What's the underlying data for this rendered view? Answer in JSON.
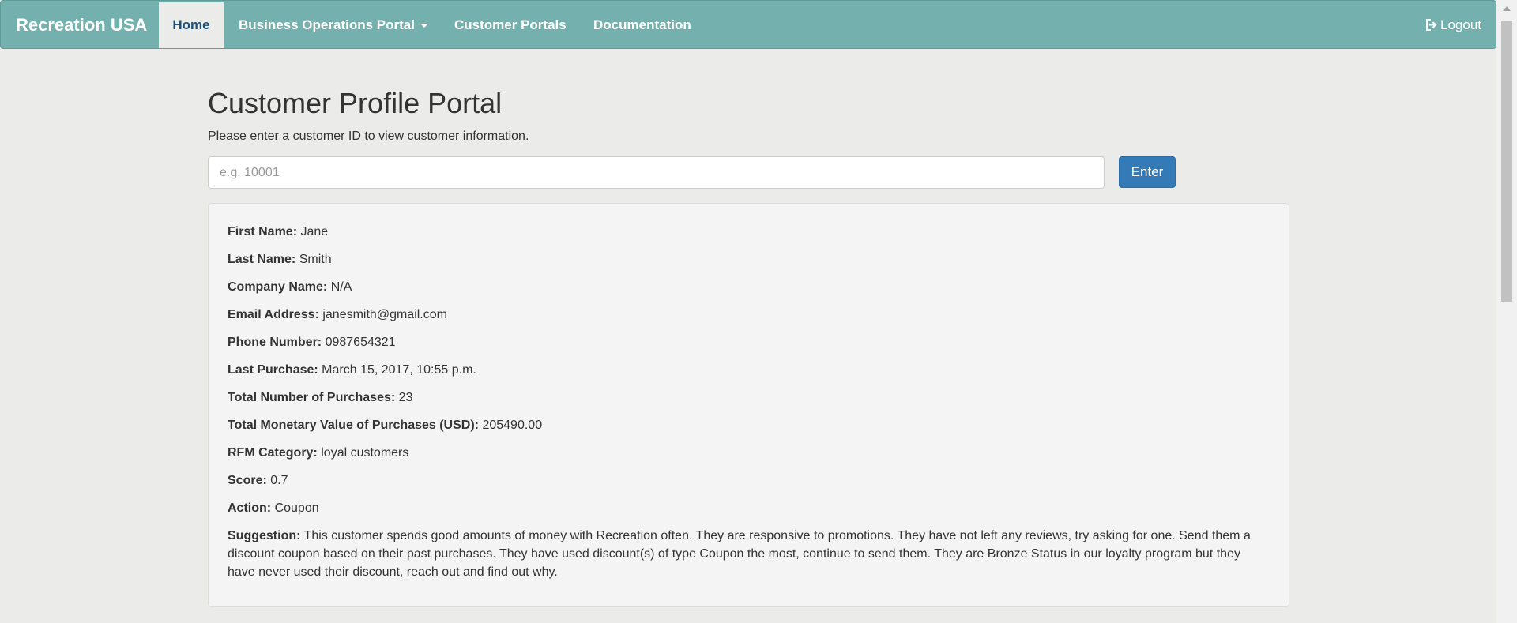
{
  "navbar": {
    "brand": "Recreation USA",
    "items": [
      {
        "label": "Home",
        "active": true
      },
      {
        "label": "Business Operations Portal",
        "dropdown": true
      },
      {
        "label": "Customer Portals"
      },
      {
        "label": "Documentation"
      }
    ],
    "logout_label": "Logout",
    "colors": {
      "bar": "#74b0ad",
      "active_text": "#1f4e79"
    }
  },
  "page": {
    "title": "Customer Profile Portal",
    "intro": "Please enter a customer ID to view customer information."
  },
  "search": {
    "placeholder": "e.g. 10001",
    "value": "",
    "button_label": "Enter"
  },
  "profile": {
    "fields": [
      {
        "label": "First Name:",
        "value": "Jane"
      },
      {
        "label": "Last Name:",
        "value": "Smith"
      },
      {
        "label": "Company Name:",
        "value": "N/A"
      },
      {
        "label": "Email Address:",
        "value": "janesmith@gmail.com"
      },
      {
        "label": "Phone Number:",
        "value": "0987654321"
      },
      {
        "label": "Last Purchase:",
        "value": "March 15, 2017, 10:55 p.m."
      },
      {
        "label": "Total Number of Purchases:",
        "value": "23"
      },
      {
        "label": "Total Monetary Value of Purchases (USD):",
        "value": "205490.00"
      },
      {
        "label": "RFM Category:",
        "value": "loyal customers"
      },
      {
        "label": "Score:",
        "value": "0.7"
      },
      {
        "label": "Action:",
        "value": "Coupon"
      },
      {
        "label": "Suggestion:",
        "value": "This customer spends good amounts of money with Recreation often. They are responsive to promotions. They have not left any reviews, try asking for one. Send them a discount coupon based on their past purchases. They have used discount(s) of type Coupon the most, continue to send them. They are Bronze Status in our loyalty program but they have never used their discount, reach out and find out why."
      }
    ]
  }
}
